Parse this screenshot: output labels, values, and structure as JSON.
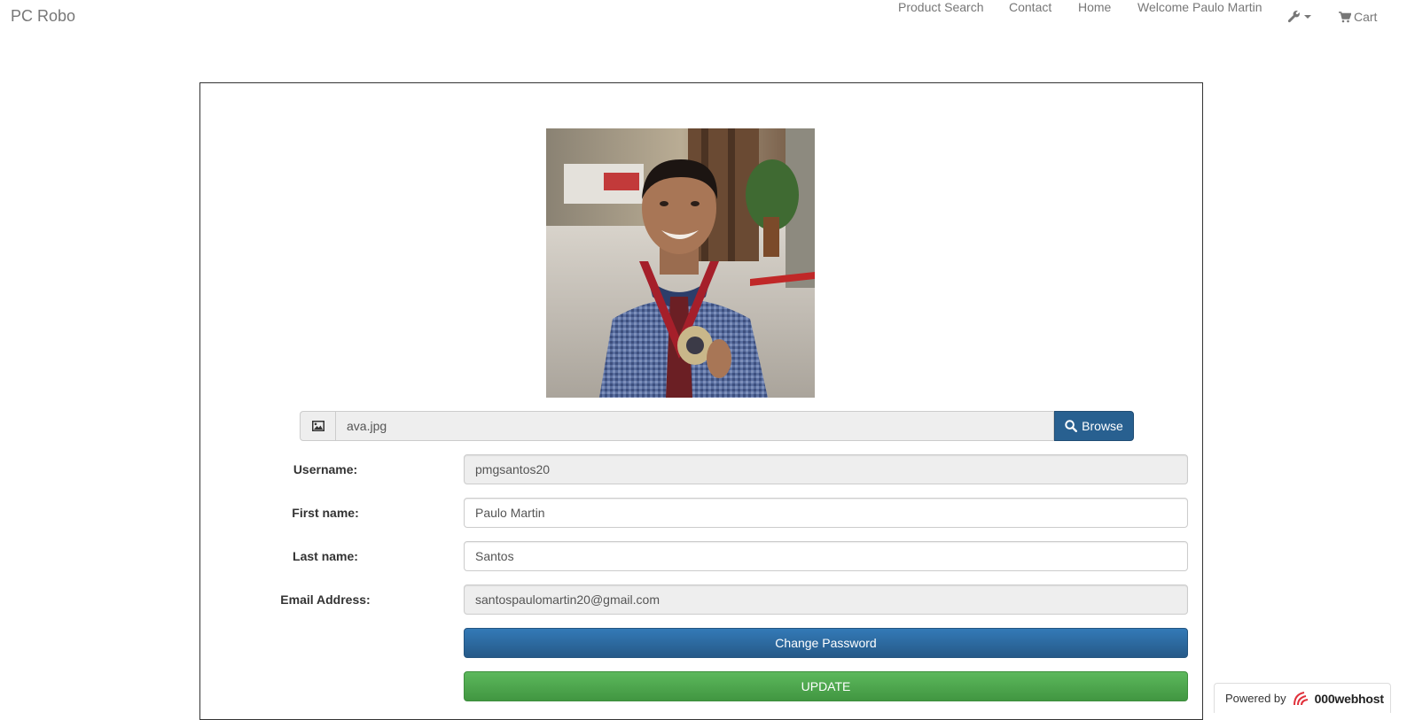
{
  "navbar": {
    "brand": "PC Robo",
    "links": {
      "product_search": "Product Search",
      "contact": "Contact",
      "home": "Home",
      "welcome": "Welcome Paulo Martin"
    },
    "tools_icon": "wrench-icon",
    "cart_label": "Cart",
    "cart_icon": "shopping-cart-icon"
  },
  "profile": {
    "avatar_alt": "ava.jpg",
    "file": {
      "icon": "picture-icon",
      "filename": "ava.jpg",
      "browse_label": "Browse",
      "browse_icon": "search-icon"
    },
    "fields": {
      "username": {
        "label": "Username:",
        "value": "pmgsantos20"
      },
      "first_name": {
        "label": "First name:",
        "value": "Paulo Martin"
      },
      "last_name": {
        "label": "Last name:",
        "value": "Santos"
      },
      "email": {
        "label": "Email Address:",
        "value": "santospaulomartin20@gmail.com"
      }
    },
    "change_password_label": "Change Password",
    "update_label": "UPDATE"
  },
  "badge": {
    "powered_by": "Powered by",
    "host": "000webhost"
  },
  "colors": {
    "primary": "#337ab7",
    "success": "#5cb85c",
    "nav_text": "#777777"
  }
}
